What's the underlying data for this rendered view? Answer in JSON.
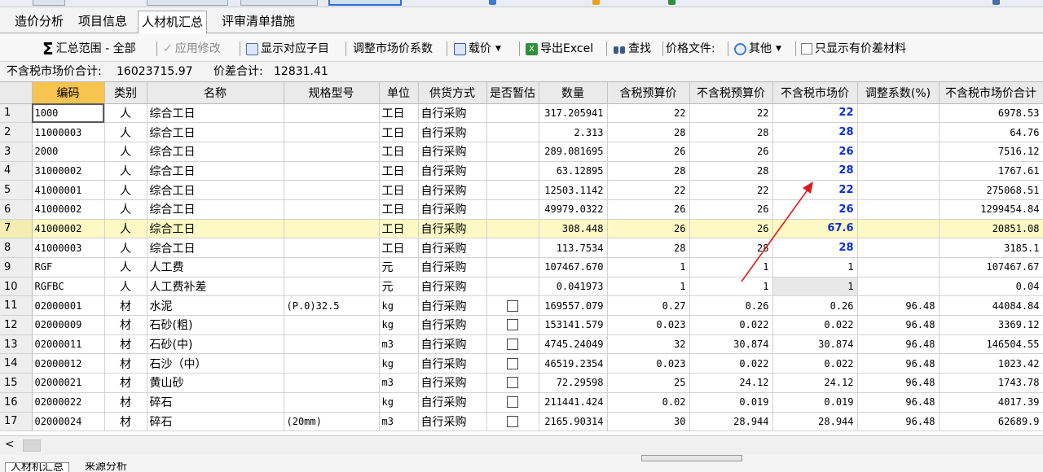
{
  "tabs": [
    "造价分析",
    "项目信息",
    "人材机汇总",
    "评审清单措施"
  ],
  "toolbar": {
    "summary_range": "汇总范围 - 全部",
    "apply_modify": "应用修改",
    "show_sub_items": "显示对应子目",
    "adjust_coef": "调整市场价系数",
    "load_price": "载价",
    "export_excel": "导出Excel",
    "find": "查找",
    "price_file": "价格文件:",
    "other": "其他",
    "only_diff": "只显示有价差材料"
  },
  "summary": {
    "market_total_label": "不含税市场价合计:",
    "market_total": "16023715.97",
    "diff_total_label": "价差合计:",
    "diff_total": "12831.41"
  },
  "columns": [
    "编码",
    "类别",
    "名称",
    "规格型号",
    "单位",
    "供货方式",
    "是否暂估",
    "数量",
    "含税预算价",
    "不含税预算价",
    "不含税市场价",
    "调整系数(%)",
    "不含税市场价合计"
  ],
  "rows": [
    {
      "no": "1",
      "code": "1000",
      "cat": "人",
      "name": "综合工日",
      "spec": "",
      "unit": "工日",
      "supply": "自行采购",
      "qty": "317.205941",
      "tax_budget": "22",
      "notax_budget": "22",
      "market": "22",
      "coef": "",
      "total": "6978.53"
    },
    {
      "no": "2",
      "code": "11000003",
      "cat": "人",
      "name": "综合工日",
      "spec": "",
      "unit": "工日",
      "supply": "自行采购",
      "qty": "2.313",
      "tax_budget": "28",
      "notax_budget": "28",
      "market": "28",
      "coef": "",
      "total": "64.76"
    },
    {
      "no": "3",
      "code": "2000",
      "cat": "人",
      "name": "综合工日",
      "spec": "",
      "unit": "工日",
      "supply": "自行采购",
      "qty": "289.081695",
      "tax_budget": "26",
      "notax_budget": "26",
      "market": "26",
      "coef": "",
      "total": "7516.12"
    },
    {
      "no": "4",
      "code": "31000002",
      "cat": "人",
      "name": "综合工日",
      "spec": "",
      "unit": "工日",
      "supply": "自行采购",
      "qty": "63.12895",
      "tax_budget": "28",
      "notax_budget": "28",
      "market": "28",
      "coef": "",
      "total": "1767.61"
    },
    {
      "no": "5",
      "code": "41000001",
      "cat": "人",
      "name": "综合工日",
      "spec": "",
      "unit": "工日",
      "supply": "自行采购",
      "qty": "12503.1142",
      "tax_budget": "22",
      "notax_budget": "22",
      "market": "22",
      "coef": "",
      "total": "275068.51"
    },
    {
      "no": "6",
      "code": "41000002",
      "cat": "人",
      "name": "综合工日",
      "spec": "",
      "unit": "工日",
      "supply": "自行采购",
      "qty": "49979.0322",
      "tax_budget": "26",
      "notax_budget": "26",
      "market": "26",
      "coef": "",
      "total": "1299454.84"
    },
    {
      "no": "7",
      "code": "41000002",
      "cat": "人",
      "name": "综合工日",
      "spec": "",
      "unit": "工日",
      "supply": "自行采购",
      "qty": "308.448",
      "tax_budget": "26",
      "notax_budget": "26",
      "market": "67.6",
      "coef": "",
      "total": "20851.08"
    },
    {
      "no": "8",
      "code": "41000003",
      "cat": "人",
      "name": "综合工日",
      "spec": "",
      "unit": "工日",
      "supply": "自行采购",
      "qty": "113.7534",
      "tax_budget": "28",
      "notax_budget": "28",
      "market": "28",
      "coef": "",
      "total": "3185.1"
    },
    {
      "no": "9",
      "code": "RGF",
      "cat": "人",
      "name": "人工费",
      "spec": "",
      "unit": "元",
      "supply": "自行采购",
      "qty": "107467.670",
      "tax_budget": "1",
      "notax_budget": "1",
      "market": "1",
      "coef": "",
      "total": "107467.67"
    },
    {
      "no": "10",
      "code": "RGFBC",
      "cat": "人",
      "name": "人工费补差",
      "spec": "",
      "unit": "元",
      "supply": "自行采购",
      "qty": "0.041973",
      "tax_budget": "1",
      "notax_budget": "1",
      "market": "1",
      "coef": "",
      "total": "0.04"
    },
    {
      "no": "11",
      "code": "02000001",
      "cat": "材",
      "name": "水泥",
      "spec": "(P.0)32.5",
      "unit": "kg",
      "supply": "自行采购",
      "qty": "169557.079",
      "tax_budget": "0.27",
      "notax_budget": "0.26",
      "market": "0.26",
      "coef": "96.48",
      "total": "44084.84"
    },
    {
      "no": "12",
      "code": "02000009",
      "cat": "材",
      "name": "石砂(粗)",
      "spec": "",
      "unit": "kg",
      "supply": "自行采购",
      "qty": "153141.579",
      "tax_budget": "0.023",
      "notax_budget": "0.022",
      "market": "0.022",
      "coef": "96.48",
      "total": "3369.12"
    },
    {
      "no": "13",
      "code": "02000011",
      "cat": "材",
      "name": "石砂(中)",
      "spec": "",
      "unit": "m3",
      "supply": "自行采购",
      "qty": "4745.24049",
      "tax_budget": "32",
      "notax_budget": "30.874",
      "market": "30.874",
      "coef": "96.48",
      "total": "146504.55"
    },
    {
      "no": "14",
      "code": "02000012",
      "cat": "材",
      "name": "石沙（中）",
      "spec": "",
      "unit": "kg",
      "supply": "自行采购",
      "qty": "46519.2354",
      "tax_budget": "0.023",
      "notax_budget": "0.022",
      "market": "0.022",
      "coef": "96.48",
      "total": "1023.42"
    },
    {
      "no": "15",
      "code": "02000021",
      "cat": "材",
      "name": "黄山砂",
      "spec": "",
      "unit": "m3",
      "supply": "自行采购",
      "qty": "72.29598",
      "tax_budget": "25",
      "notax_budget": "24.12",
      "market": "24.12",
      "coef": "96.48",
      "total": "1743.78"
    },
    {
      "no": "16",
      "code": "02000022",
      "cat": "材",
      "name": "碎石",
      "spec": "",
      "unit": "kg",
      "supply": "自行采购",
      "qty": "211441.424",
      "tax_budget": "0.02",
      "notax_budget": "0.019",
      "market": "0.019",
      "coef": "96.48",
      "total": "4017.39"
    },
    {
      "no": "17",
      "code": "02000024",
      "cat": "材",
      "name": "碎石",
      "spec": "(20mm)",
      "unit": "m3",
      "supply": "自行采购",
      "qty": "2165.90314",
      "tax_budget": "30",
      "notax_budget": "28.944",
      "market": "28.944",
      "coef": "96.48",
      "total": "62689.9"
    }
  ],
  "bottom_tabs": [
    "人材机汇总",
    "来源分析"
  ],
  "colors": {
    "code_header": "#f6c44f",
    "market_blue": "#0b2fd6",
    "highlight_row": "#fdf9c4",
    "arrow_red": "#e0191d"
  },
  "icons": [
    "sigma-icon",
    "check-icon",
    "sub-items-icon",
    "load-price-icon",
    "excel-icon",
    "binoculars-icon",
    "gear-icon",
    "checkbox-icon",
    "red-arrow-annotation"
  ]
}
